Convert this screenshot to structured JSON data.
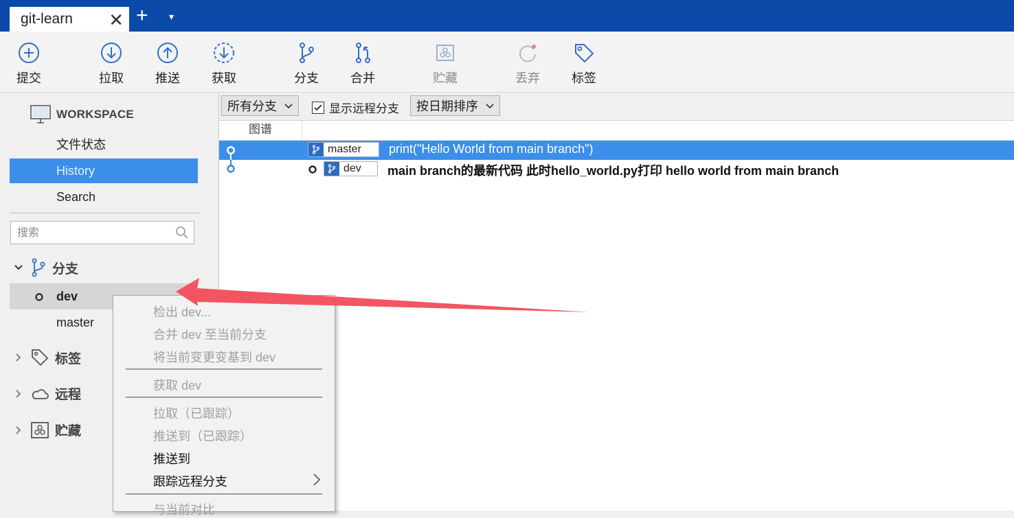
{
  "tab": {
    "title": "git-learn",
    "close": "✕",
    "new_tab": "+",
    "menu": "▾"
  },
  "toolbar": [
    {
      "label": "提交",
      "icon": "plus-circle-icon"
    },
    {
      "label": "拉取",
      "icon": "arrow-down-circle-icon"
    },
    {
      "label": "推送",
      "icon": "arrow-up-circle-icon"
    },
    {
      "label": "获取",
      "icon": "dashed-arrow-down-circle-icon"
    },
    {
      "label": "分支",
      "icon": "branch-icon"
    },
    {
      "label": "合并",
      "icon": "merge-icon"
    },
    {
      "label": "贮藏",
      "icon": "stash-icon",
      "disabled": true
    },
    {
      "label": "丢弃",
      "icon": "discard-icon",
      "disabled": true
    },
    {
      "label": "标签",
      "icon": "tag-icon"
    }
  ],
  "sidebar": {
    "workspace_label": "WORKSPACE",
    "nav": [
      "文件状态",
      "History",
      "Search"
    ],
    "selected_nav": "History",
    "search_placeholder": "搜索",
    "groups": {
      "branches": "分支",
      "tags": "标签",
      "remotes": "远程",
      "stashes": "贮藏"
    },
    "branches": [
      {
        "name": "dev",
        "current": true
      },
      {
        "name": "master",
        "current": false
      }
    ]
  },
  "filter": {
    "branch_filter": "所有分支",
    "show_remote_label": "显示远程分支",
    "show_remote_checked": true,
    "sort": "按日期排序"
  },
  "columns": {
    "graph": "图谱"
  },
  "commits": [
    {
      "branch": "master",
      "message": "print(\"Hello World from main branch\")",
      "selected": true,
      "bold": false
    },
    {
      "branch": "dev",
      "message": "main branch的最新代码 此时hello_world.py打印 hello world from main branch",
      "selected": false,
      "bold": true
    }
  ],
  "context_menu": {
    "items": [
      {
        "label": "检出 dev...",
        "enabled": false
      },
      {
        "label": "合并 dev 至当前分支",
        "enabled": false
      },
      {
        "label": "将当前变更变基到 dev",
        "enabled": false
      },
      {
        "label": "获取 dev",
        "enabled": false
      },
      {
        "label": "拉取（已跟踪）",
        "enabled": false
      },
      {
        "label": "推送到（已跟踪）",
        "enabled": false
      },
      {
        "label": "推送到",
        "enabled": true
      },
      {
        "label": "跟踪远程分支",
        "enabled": true,
        "submenu": true
      },
      {
        "label": "与当前对比",
        "enabled": false
      }
    ]
  },
  "colors": {
    "titlebar": "#0b4aa8",
    "selection": "#3b8eea",
    "annotation_arrow": "#f25562"
  }
}
